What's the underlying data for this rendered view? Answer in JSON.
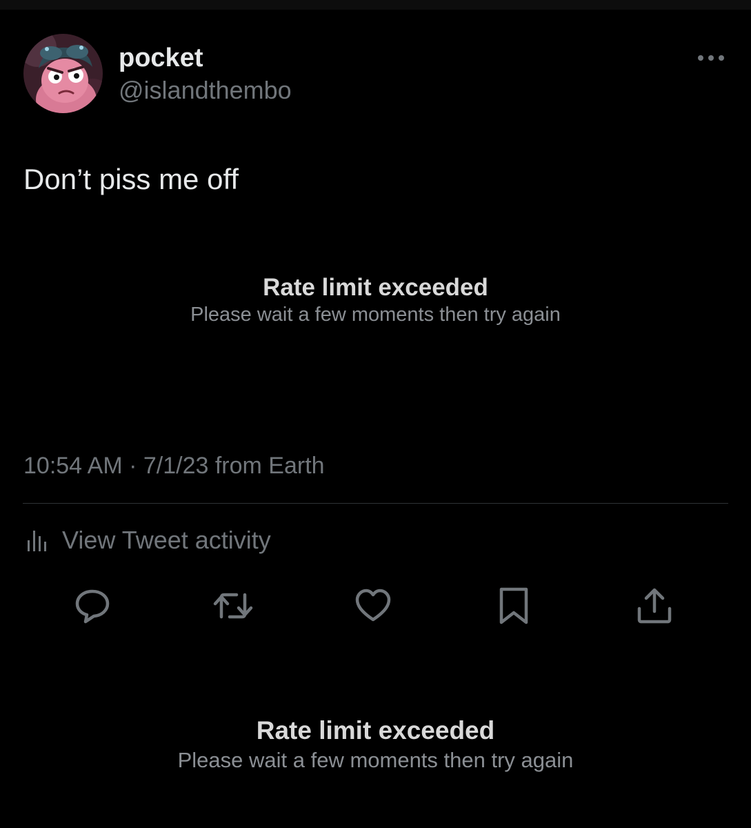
{
  "tweet": {
    "author": {
      "display_name": "pocket",
      "handle": "@islandthembo"
    },
    "text": "Don’t piss me off",
    "timestamp": "10:54 AM · 7/1/23 from Earth"
  },
  "notices": [
    {
      "title": "Rate limit exceeded",
      "subtitle": "Please wait a few moments then try again"
    },
    {
      "title": "Rate limit exceeded",
      "subtitle": "Please wait a few moments then try again"
    }
  ],
  "activity": {
    "label": "View Tweet activity",
    "icon": "bar-chart-icon"
  },
  "actions": [
    {
      "name": "reply",
      "icon": "reply-icon"
    },
    {
      "name": "retweet",
      "icon": "retweet-icon"
    },
    {
      "name": "like",
      "icon": "heart-icon"
    },
    {
      "name": "bookmark",
      "icon": "bookmark-icon"
    },
    {
      "name": "share",
      "icon": "share-icon"
    }
  ],
  "colors": {
    "background": "#000000",
    "primary_text": "#e7e9ea",
    "secondary_text": "#71767b",
    "divider": "#2f3336"
  }
}
